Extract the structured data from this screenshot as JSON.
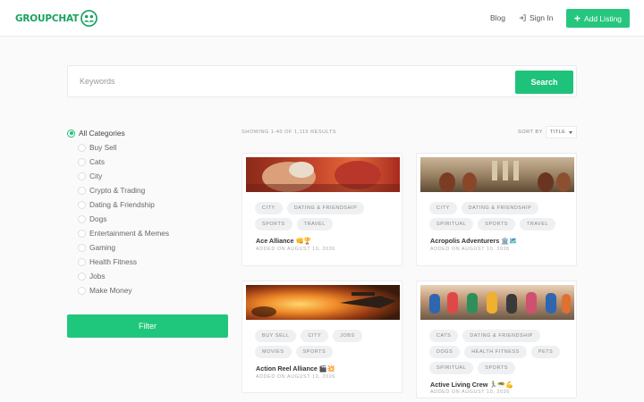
{
  "header": {
    "logo_text": "GROUPCHAT",
    "nav_blog": "Blog",
    "nav_signin": "Sign In",
    "add_listing": "Add Listing",
    "brand_color": "#1aa260",
    "accent_color": "#27c67f"
  },
  "search": {
    "placeholder": "Keywords",
    "value": "",
    "button": "Search"
  },
  "categories": {
    "items": [
      {
        "label": "All Categories",
        "selected": true
      },
      {
        "label": "Buy Sell"
      },
      {
        "label": "Cats"
      },
      {
        "label": "City"
      },
      {
        "label": "Crypto & Trading"
      },
      {
        "label": "Dating & Friendship"
      },
      {
        "label": "Dogs"
      },
      {
        "label": "Entertainment & Memes"
      },
      {
        "label": "Gaming"
      },
      {
        "label": "Health Fitness"
      },
      {
        "label": "Jobs"
      },
      {
        "label": "Make Money"
      }
    ],
    "filter_button": "Filter"
  },
  "results": {
    "count_text": "SHOWING 1-40 OF 1,115 RESULTS",
    "sort_label": "SORT BY",
    "sort_value": "TITLE"
  },
  "listings": [
    {
      "title": "Ace Alliance 👊🏆",
      "date": "ADDED ON AUGUST 10, 2026",
      "tags": [
        "CITY",
        "DATING & FRIENDSHIP",
        "SPORTS",
        "TRAVEL"
      ]
    },
    {
      "title": "Acropolis Adventurers 🏛️🗺️",
      "date": "ADDED ON AUGUST 10, 2026",
      "tags": [
        "CITY",
        "DATING & FRIENDSHIP",
        "SPIRITUAL",
        "SPORTS",
        "TRAVEL"
      ]
    },
    {
      "title": "Action Reel Alliance 🎬💥",
      "date": "ADDED ON AUGUST 10, 2026",
      "tags": [
        "BUY SELL",
        "CITY",
        "JOBS",
        "MOVIES",
        "SPORTS"
      ]
    },
    {
      "title": "Active Living Crew 🏃‍♂️🥗💪",
      "date": "ADDED ON AUGUST 10, 2026",
      "tags": [
        "CATS",
        "DATING & FRIENDSHIP",
        "DOGS",
        "HEALTH FITNESS",
        "PETS",
        "SPIRITUAL",
        "SPORTS"
      ]
    }
  ],
  "icons": {
    "logo": "group-chat-icon",
    "signin": "sign-in-icon",
    "add": "plus-icon",
    "sort": "caret-down-icon"
  }
}
